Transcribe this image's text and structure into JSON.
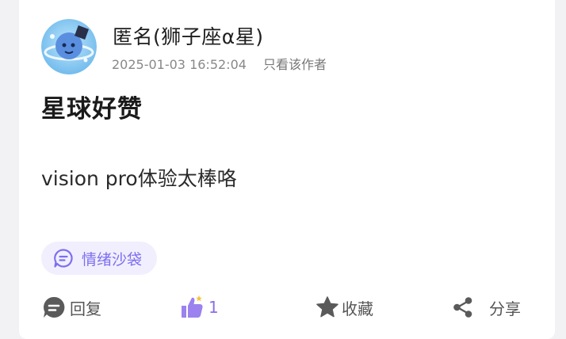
{
  "author": {
    "name": "匿名(狮子座α星)",
    "timestamp": "2025-01-03 16:52:04",
    "only_author_label": "只看该作者"
  },
  "post": {
    "title": "星球好赞",
    "body": "vision pro体验太棒咯"
  },
  "tag": {
    "label": "情绪沙袋",
    "icon": "chat-bubble-icon"
  },
  "actions": {
    "reply_label": "回复",
    "like_count": "1",
    "favorite_label": "收藏",
    "share_label": "分享"
  },
  "colors": {
    "accent": "#7d6ff0",
    "tag_bg": "#f1effd",
    "icon_gray": "#5a5a5a",
    "like_purple": "#9b82ee"
  }
}
